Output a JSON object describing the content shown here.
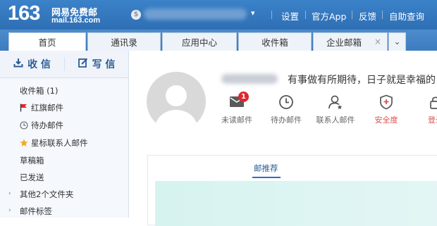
{
  "header": {
    "logo_number": "163",
    "logo_name": "网易免费邮",
    "logo_domain": "mail.163.com",
    "account_caret": "▾",
    "links": [
      "设置",
      "官方App",
      "反馈",
      "自助查询"
    ]
  },
  "tabs": [
    {
      "label": "首页",
      "active": true
    },
    {
      "label": "通讯录",
      "active": false
    },
    {
      "label": "应用中心",
      "active": false
    },
    {
      "label": "收件箱",
      "active": false
    },
    {
      "label": "企业邮箱",
      "active": false,
      "closable": true
    }
  ],
  "tab_close": "×",
  "tab_more": "⌄",
  "sidebar": {
    "receive_label": "收 信",
    "write_label": "写 信",
    "items": [
      {
        "label": "收件箱 (1)",
        "icon": "none"
      },
      {
        "label": "红旗邮件",
        "icon": "red-flag-icon"
      },
      {
        "label": "待办邮件",
        "icon": "clock-icon"
      },
      {
        "label": "星标联系人邮件",
        "icon": "star-icon"
      },
      {
        "label": "草稿箱",
        "icon": "none"
      },
      {
        "label": "已发送",
        "icon": "none"
      },
      {
        "label": "其他2个文件夹",
        "icon": "none",
        "expandable": true
      },
      {
        "label": "邮件标签",
        "icon": "none",
        "expandable": true
      }
    ]
  },
  "main": {
    "motto": "有事做有所期待，日子就是幸福的",
    "quick_actions": [
      {
        "label": "未读邮件",
        "icon": "mail-icon",
        "badge": "1"
      },
      {
        "label": "待办邮件",
        "icon": "clock-icon"
      },
      {
        "label": "联系人邮件",
        "icon": "contact-icon"
      },
      {
        "label": "安全度",
        "icon": "shield-icon"
      },
      {
        "label": "登录",
        "icon": "lock-icon"
      }
    ],
    "card_tab": "邮推荐"
  },
  "colors": {
    "header_blue": "#2f6fb4",
    "accent_blue": "#2b6fc0",
    "badge_red": "#e0262d",
    "safety_red": "#d9534f"
  }
}
